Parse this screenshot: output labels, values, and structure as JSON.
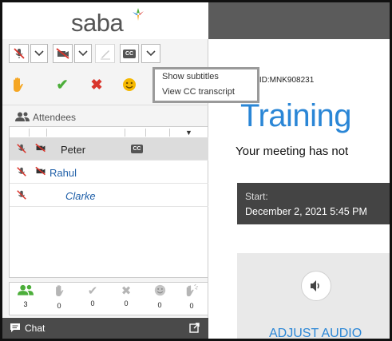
{
  "app": {
    "logo_text": "saba"
  },
  "cc_menu": {
    "items": [
      {
        "label": "Show subtitles"
      },
      {
        "label": "View CC transcript"
      }
    ]
  },
  "attendees": {
    "header_label": "Attendees",
    "rows": [
      {
        "name": "Peter",
        "selected": true,
        "cc_badge": "CC"
      },
      {
        "name": "Rahul",
        "selected": false
      },
      {
        "name": "Clarke",
        "selected": false
      }
    ]
  },
  "counters": [
    {
      "icon": "attendees-icon",
      "value": "3"
    },
    {
      "icon": "raise-hand-icon",
      "value": "0"
    },
    {
      "icon": "agree-icon",
      "value": "0"
    },
    {
      "icon": "disagree-icon",
      "value": "0"
    },
    {
      "icon": "smile-icon",
      "value": "0"
    },
    {
      "icon": "applause-icon",
      "value": "0"
    }
  ],
  "toolbar": {
    "cc_label": "CC"
  },
  "chat": {
    "label": "Chat"
  },
  "meeting": {
    "id_text": "ng ID:MNK908231",
    "title": "Training",
    "status": "Your meeting has not",
    "start_label": "Start:",
    "start_value": "December 2, 2021 5:45 PM"
  },
  "audio": {
    "label": "ADJUST AUDIO"
  },
  "colors": {
    "accent_blue": "#2a86d6",
    "red": "#d9342b",
    "green": "#4cae3a",
    "orange": "#f5a623"
  }
}
